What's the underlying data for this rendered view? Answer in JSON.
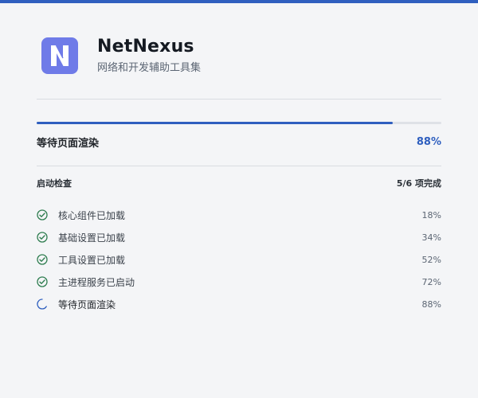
{
  "app": {
    "title": "NetNexus",
    "subtitle": "网络和开发辅助工具集",
    "logo_letter": "N"
  },
  "loading": {
    "progress": 0.88,
    "status_label": "等待页面渲染",
    "percent_text": "88%"
  },
  "checks": {
    "title": "启动检查",
    "summary": "5/6 项完成",
    "items": [
      {
        "label": "核心组件已加载",
        "percent": "18%",
        "state": "done"
      },
      {
        "label": "基础设置已加载",
        "percent": "34%",
        "state": "done"
      },
      {
        "label": "工具设置已加载",
        "percent": "52%",
        "state": "done"
      },
      {
        "label": "主进程服务已启动",
        "percent": "72%",
        "state": "done"
      },
      {
        "label": "等待页面渲染",
        "percent": "88%",
        "state": "pending"
      }
    ]
  },
  "colors": {
    "accent": "#2f5fbf",
    "logo_bg": "#6f7be8",
    "success": "#2e7d4f",
    "track": "#dfe2e7",
    "background": "#f4f5f7"
  },
  "icons": {
    "done": "check-circle-icon",
    "pending": "spinner-icon"
  }
}
